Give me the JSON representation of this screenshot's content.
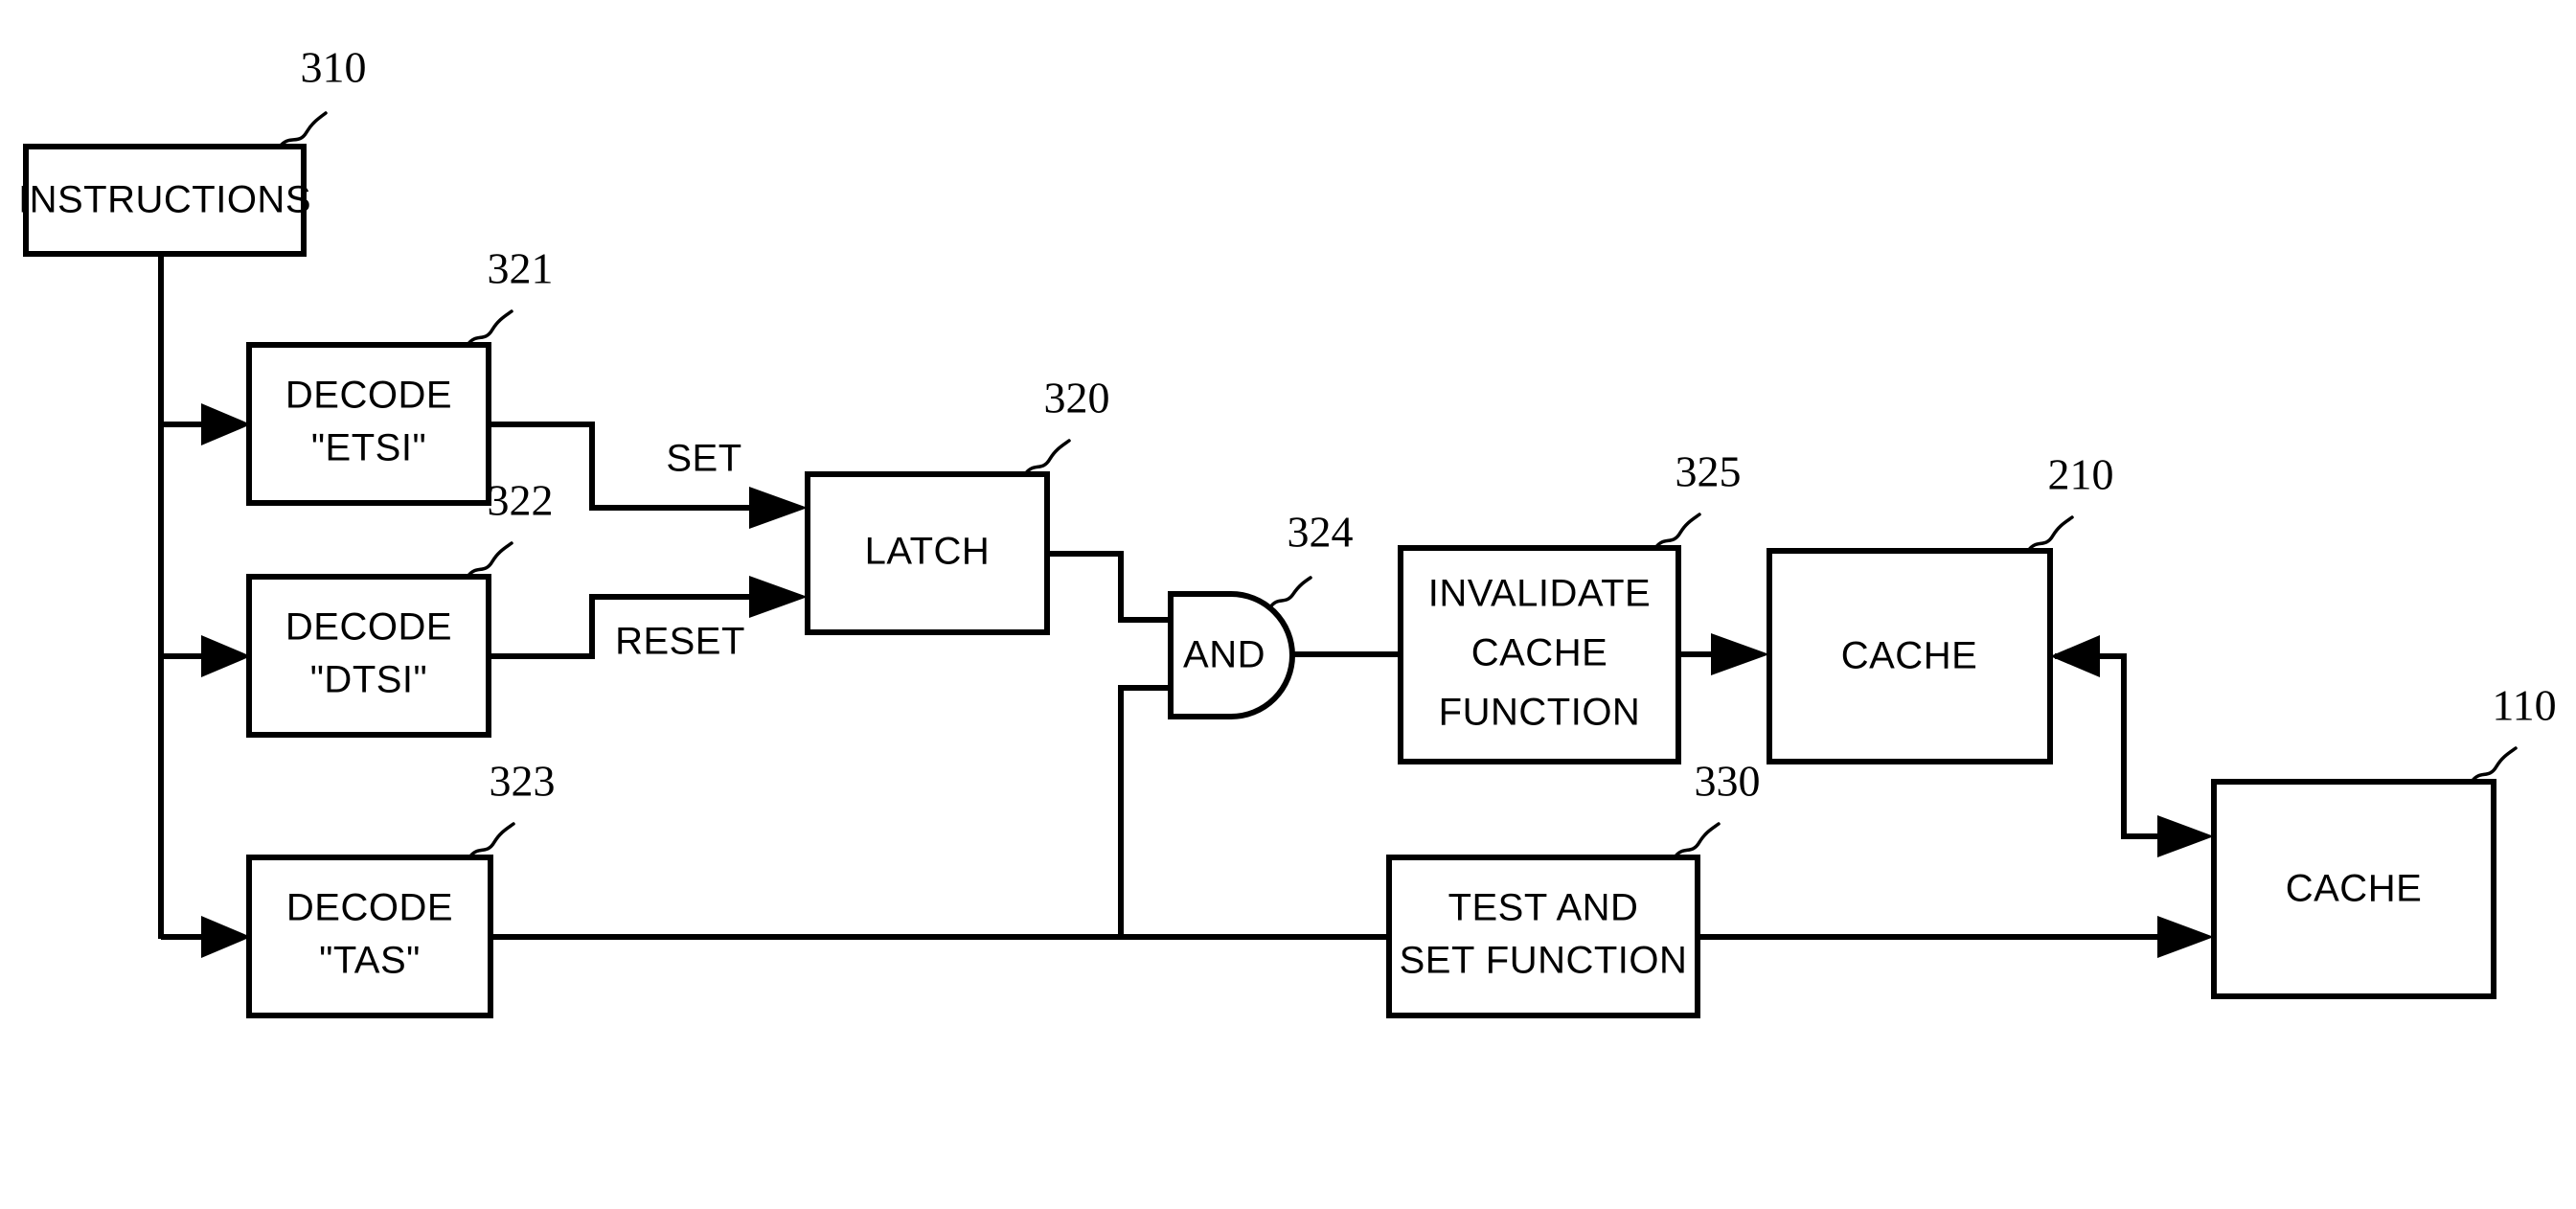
{
  "figure": {
    "kind": "patent-block-diagram",
    "ink_color": "#000000",
    "background_color": "#ffffff",
    "blocks": [
      {
        "id": "instructions",
        "label": "INSTRUCTIONS",
        "ref": "310"
      },
      {
        "id": "decode-etsi",
        "label_line1": "DECODE",
        "label_line2": "\"ETSI\"",
        "ref": "321"
      },
      {
        "id": "decode-dtsi",
        "label_line1": "DECODE",
        "label_line2": "\"DTSI\"",
        "ref": "322"
      },
      {
        "id": "decode-tas",
        "label_line1": "DECODE",
        "label_line2": "\"TAS\"",
        "ref": "323"
      },
      {
        "id": "latch",
        "label": "LATCH",
        "ref": "320"
      },
      {
        "id": "and-gate",
        "label": "AND",
        "ref": "324"
      },
      {
        "id": "invalidate-cache-function",
        "label_line1": "INVALIDATE",
        "label_line2": "CACHE",
        "label_line3": "FUNCTION",
        "ref": "325"
      },
      {
        "id": "cache-210",
        "label": "CACHE",
        "ref": "210"
      },
      {
        "id": "test-and-set-function",
        "label_line1": "TEST AND",
        "label_line2": "SET FUNCTION",
        "ref": "330"
      },
      {
        "id": "cache-110",
        "label": "CACHE",
        "ref": "110"
      }
    ],
    "wire_labels": [
      {
        "id": "set",
        "text": "SET"
      },
      {
        "id": "reset",
        "text": "RESET"
      }
    ],
    "texts": {
      "instructions": "INSTRUCTIONS",
      "decode": "DECODE",
      "etsi": "\"ETSI\"",
      "dtsi": "\"DTSI\"",
      "tas": "\"TAS\"",
      "latch": "LATCH",
      "and": "AND",
      "invalidate": "INVALIDATE",
      "cache": "CACHE",
      "function": "FUNCTION",
      "test_and": "TEST AND",
      "set_function": "SET FUNCTION",
      "set": "SET",
      "reset": "RESET"
    },
    "refs": {
      "r310": "310",
      "r321": "321",
      "r322": "322",
      "r323": "323",
      "r320": "320",
      "r324": "324",
      "r325": "325",
      "r210": "210",
      "r330": "330",
      "r110": "110"
    }
  }
}
